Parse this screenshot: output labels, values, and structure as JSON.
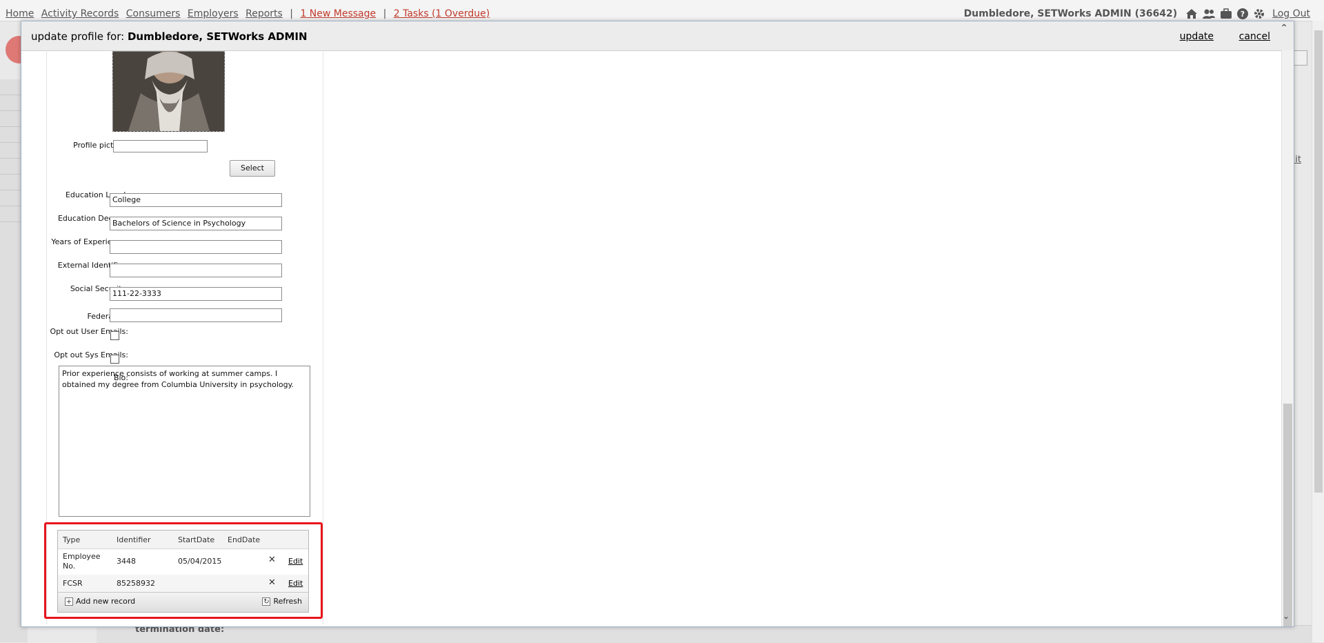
{
  "topnav": {
    "links": [
      "Home",
      "Activity Records",
      "Consumers",
      "Employers",
      "Reports"
    ],
    "messages": "1 New Message",
    "tasks": "2 Tasks (1 Overdue)",
    "user": "Dumbledore, SETWorks ADMIN (36642)",
    "logout": "Log Out",
    "icons": [
      "home-icon",
      "users-icon",
      "briefcase-icon",
      "help-icon",
      "gear-icon"
    ]
  },
  "background": {
    "edit_link": "dit",
    "termination_label": "termination date:"
  },
  "modal": {
    "title_prefix": "update profile for:",
    "title_name": "Dumbledore, SETWorks ADMIN",
    "update_label": "update",
    "cancel_label": "cancel"
  },
  "form": {
    "profile_picture_label": "Profile picture:",
    "profile_picture_value": "",
    "select_label": "Select",
    "education_level_label": "Education Level:",
    "education_level_value": "College",
    "education_degree_label": "Education Degree:",
    "education_degree_value": "Bachelors of Science in Psychology",
    "years_experience_label": "Years of Experience:",
    "years_experience_value": "",
    "external_identifier_label": "External Identifier:",
    "external_identifier_value": "",
    "social_security_label": "Social Security:",
    "social_security_value": "111-22-3333",
    "federal_id_label": "Federal ID:",
    "federal_id_value": "",
    "opt_out_user_label": "Opt out User Emails:",
    "opt_out_sys_label": "Opt out Sys Emails:",
    "bio_label": "Bio:",
    "bio_value": "Prior experience consists of working at summer camps. I obtained my degree from Columbia University in psychology."
  },
  "records": {
    "columns": [
      "Type",
      "Identifier",
      "StartDate",
      "EndDate"
    ],
    "rows": [
      {
        "type": "Employee No.",
        "identifier": "3448",
        "start": "05/04/2015",
        "end": "",
        "edit": "Edit"
      },
      {
        "type": "FCSR",
        "identifier": "85258932",
        "start": "",
        "end": "",
        "edit": "Edit"
      }
    ],
    "add_label": "Add new record",
    "refresh_label": "Refresh"
  }
}
